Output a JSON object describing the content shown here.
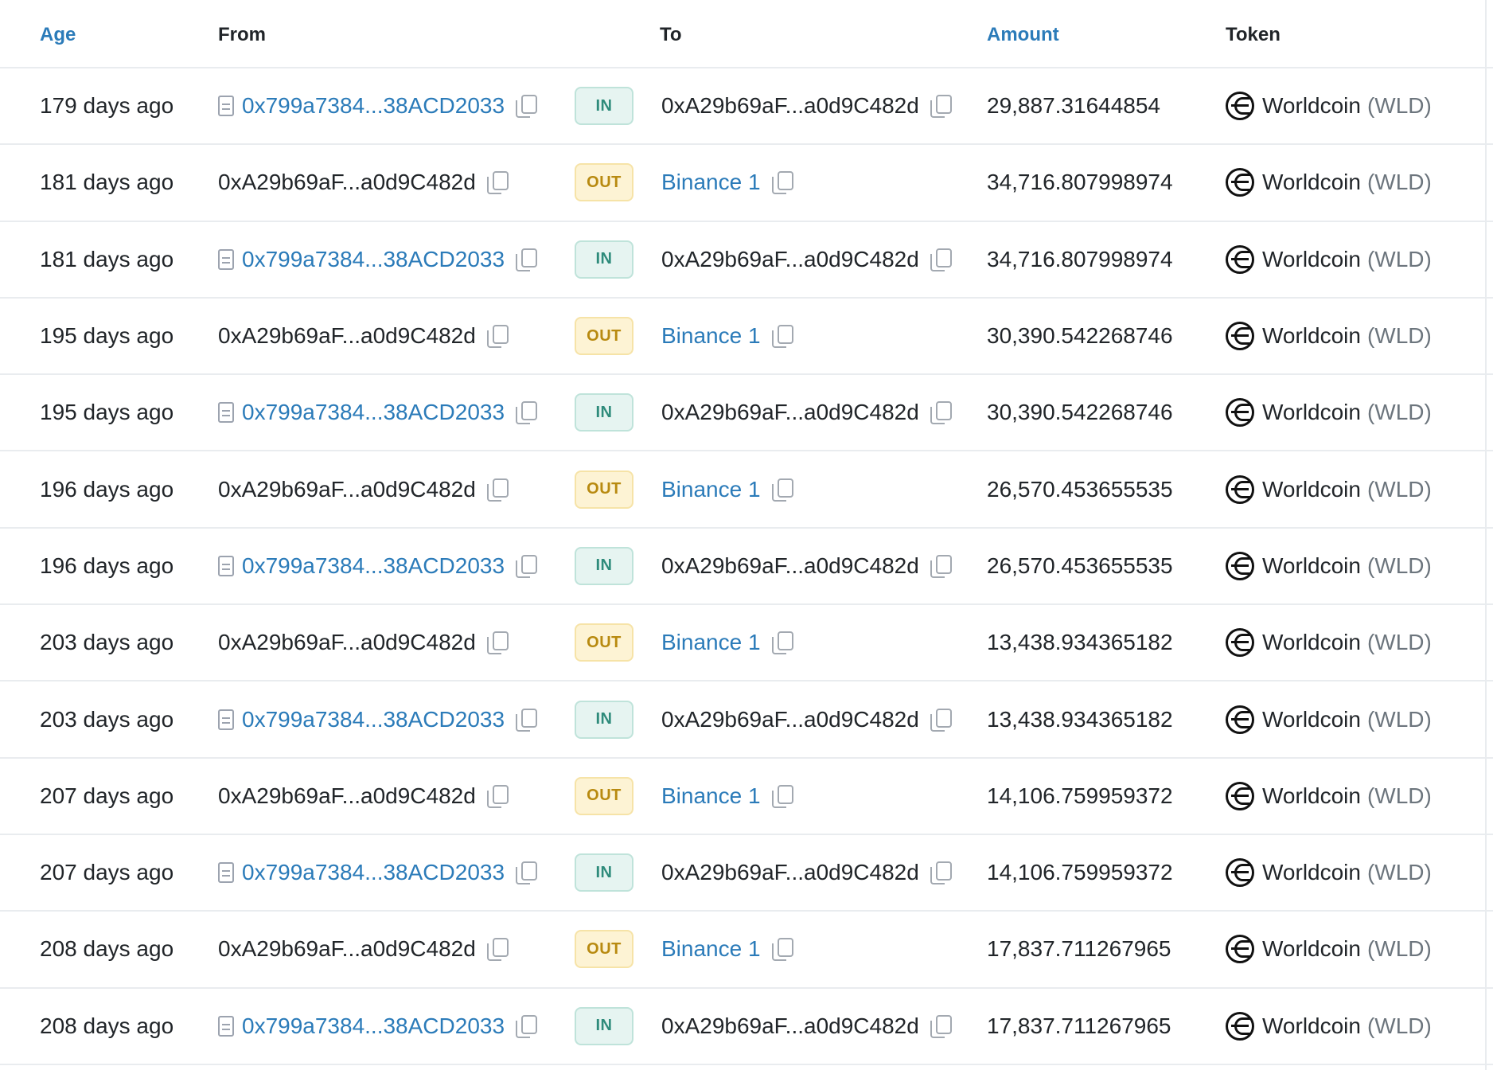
{
  "headers": {
    "age": "Age",
    "from": "From",
    "to": "To",
    "amount": "Amount",
    "token": "Token"
  },
  "colors": {
    "link": "#2b7bb9",
    "in_badge_bg": "#e6f4f1",
    "in_badge_text": "#2e8b7b",
    "out_badge_bg": "#fdf3d4",
    "out_badge_text": "#b88a10",
    "divider": "#e9ecef"
  },
  "rows": [
    {
      "age": "179 days ago",
      "from": "0x799a7384...38ACD2033",
      "from_contract": true,
      "dir": "IN",
      "to": "0xA29b69aF...a0d9C482d",
      "to_link": false,
      "amount": "29,887.31644854",
      "token_name": "Worldcoin",
      "token_sym": "(WLD)"
    },
    {
      "age": "181 days ago",
      "from": "0xA29b69aF...a0d9C482d",
      "from_contract": false,
      "dir": "OUT",
      "to": "Binance 1",
      "to_link": true,
      "amount": "34,716.807998974",
      "token_name": "Worldcoin",
      "token_sym": "(WLD)"
    },
    {
      "age": "181 days ago",
      "from": "0x799a7384...38ACD2033",
      "from_contract": true,
      "dir": "IN",
      "to": "0xA29b69aF...a0d9C482d",
      "to_link": false,
      "amount": "34,716.807998974",
      "token_name": "Worldcoin",
      "token_sym": "(WLD)"
    },
    {
      "age": "195 days ago",
      "from": "0xA29b69aF...a0d9C482d",
      "from_contract": false,
      "dir": "OUT",
      "to": "Binance 1",
      "to_link": true,
      "amount": "30,390.542268746",
      "token_name": "Worldcoin",
      "token_sym": "(WLD)"
    },
    {
      "age": "195 days ago",
      "from": "0x799a7384...38ACD2033",
      "from_contract": true,
      "dir": "IN",
      "to": "0xA29b69aF...a0d9C482d",
      "to_link": false,
      "amount": "30,390.542268746",
      "token_name": "Worldcoin",
      "token_sym": "(WLD)"
    },
    {
      "age": "196 days ago",
      "from": "0xA29b69aF...a0d9C482d",
      "from_contract": false,
      "dir": "OUT",
      "to": "Binance 1",
      "to_link": true,
      "amount": "26,570.453655535",
      "token_name": "Worldcoin",
      "token_sym": "(WLD)"
    },
    {
      "age": "196 days ago",
      "from": "0x799a7384...38ACD2033",
      "from_contract": true,
      "dir": "IN",
      "to": "0xA29b69aF...a0d9C482d",
      "to_link": false,
      "amount": "26,570.453655535",
      "token_name": "Worldcoin",
      "token_sym": "(WLD)"
    },
    {
      "age": "203 days ago",
      "from": "0xA29b69aF...a0d9C482d",
      "from_contract": false,
      "dir": "OUT",
      "to": "Binance 1",
      "to_link": true,
      "amount": "13,438.934365182",
      "token_name": "Worldcoin",
      "token_sym": "(WLD)"
    },
    {
      "age": "203 days ago",
      "from": "0x799a7384...38ACD2033",
      "from_contract": true,
      "dir": "IN",
      "to": "0xA29b69aF...a0d9C482d",
      "to_link": false,
      "amount": "13,438.934365182",
      "token_name": "Worldcoin",
      "token_sym": "(WLD)"
    },
    {
      "age": "207 days ago",
      "from": "0xA29b69aF...a0d9C482d",
      "from_contract": false,
      "dir": "OUT",
      "to": "Binance 1",
      "to_link": true,
      "amount": "14,106.759959372",
      "token_name": "Worldcoin",
      "token_sym": "(WLD)"
    },
    {
      "age": "207 days ago",
      "from": "0x799a7384...38ACD2033",
      "from_contract": true,
      "dir": "IN",
      "to": "0xA29b69aF...a0d9C482d",
      "to_link": false,
      "amount": "14,106.759959372",
      "token_name": "Worldcoin",
      "token_sym": "(WLD)"
    },
    {
      "age": "208 days ago",
      "from": "0xA29b69aF...a0d9C482d",
      "from_contract": false,
      "dir": "OUT",
      "to": "Binance 1",
      "to_link": true,
      "amount": "17,837.711267965",
      "token_name": "Worldcoin",
      "token_sym": "(WLD)"
    },
    {
      "age": "208 days ago",
      "from": "0x799a7384...38ACD2033",
      "from_contract": true,
      "dir": "IN",
      "to": "0xA29b69aF...a0d9C482d",
      "to_link": false,
      "amount": "17,837.711267965",
      "token_name": "Worldcoin",
      "token_sym": "(WLD)"
    }
  ]
}
